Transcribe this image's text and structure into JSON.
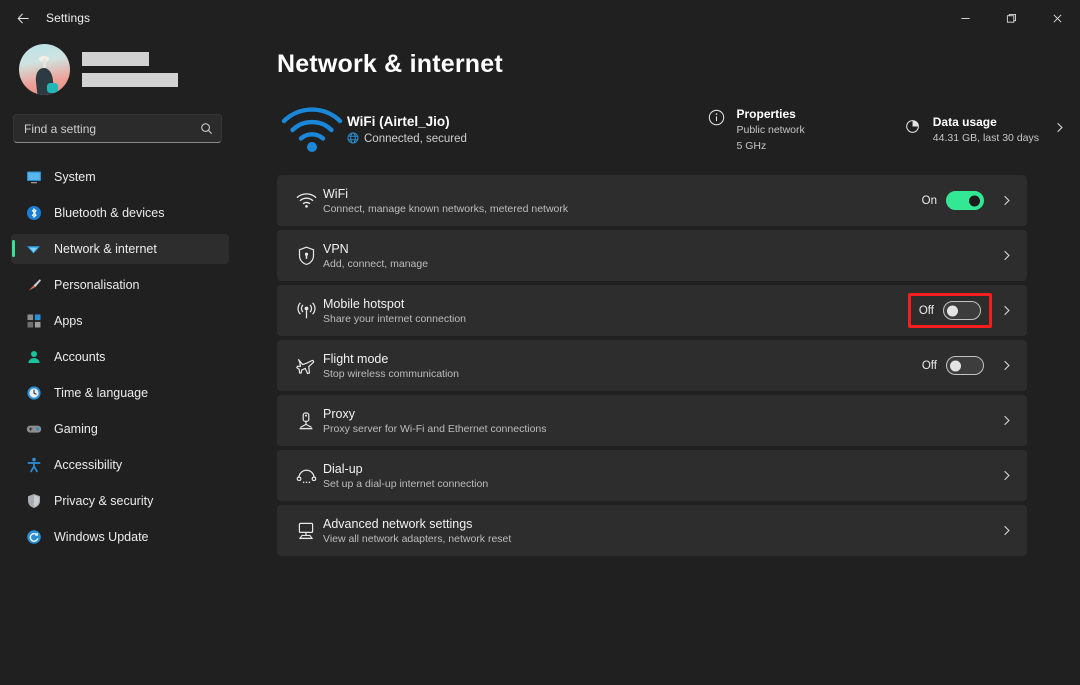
{
  "window": {
    "title": "Settings",
    "back_icon": "back-arrow-icon",
    "minimize_label": "—",
    "restore_label": "❐",
    "close_label": "✕"
  },
  "account": {
    "name_redacted": true
  },
  "search": {
    "placeholder": "Find a setting",
    "value": "",
    "icon": "search-icon"
  },
  "sidebar": {
    "items": [
      {
        "label": "System",
        "icon": "system-icon",
        "active": false
      },
      {
        "label": "Bluetooth & devices",
        "icon": "bluetooth-icon",
        "active": false
      },
      {
        "label": "Network & internet",
        "icon": "network-icon",
        "active": true
      },
      {
        "label": "Personalisation",
        "icon": "brush-icon",
        "active": false
      },
      {
        "label": "Apps",
        "icon": "apps-icon",
        "active": false
      },
      {
        "label": "Accounts",
        "icon": "accounts-icon",
        "active": false
      },
      {
        "label": "Time & language",
        "icon": "clock-icon",
        "active": false
      },
      {
        "label": "Gaming",
        "icon": "gamepad-icon",
        "active": false
      },
      {
        "label": "Accessibility",
        "icon": "accessibility-icon",
        "active": false
      },
      {
        "label": "Privacy & security",
        "icon": "shield-icon",
        "active": false
      },
      {
        "label": "Windows Update",
        "icon": "update-icon",
        "active": false
      }
    ]
  },
  "page": {
    "title": "Network & internet"
  },
  "summary": {
    "wifi_icon": "wifi-icon",
    "ssid": "WiFi (Airtel_Jio)",
    "status": "Connected, secured",
    "status_icon": "globe-icon",
    "properties": {
      "icon": "info-icon",
      "title": "Properties",
      "line1": "Public network",
      "line2": "5 GHz"
    },
    "data_usage": {
      "icon": "pie-chart-icon",
      "title": "Data usage",
      "detail": "44.31 GB, last 30 days",
      "chevron": "chevron-right-icon"
    }
  },
  "rows": [
    {
      "icon": "wifi-icon",
      "title": "WiFi",
      "subtitle": "Connect, manage known networks, metered network",
      "toggle": {
        "present": true,
        "state": "On",
        "on": true,
        "highlighted": false
      },
      "chevron": "chevron-right-icon"
    },
    {
      "icon": "vpn-shield-icon",
      "title": "VPN",
      "subtitle": "Add, connect, manage",
      "toggle": {
        "present": false,
        "state": "",
        "on": false,
        "highlighted": false
      },
      "chevron": "chevron-right-icon"
    },
    {
      "icon": "hotspot-icon",
      "title": "Mobile hotspot",
      "subtitle": "Share your internet connection",
      "toggle": {
        "present": true,
        "state": "Off",
        "on": false,
        "highlighted": true
      },
      "chevron": "chevron-right-icon"
    },
    {
      "icon": "airplane-icon",
      "title": "Flight mode",
      "subtitle": "Stop wireless communication",
      "toggle": {
        "present": true,
        "state": "Off",
        "on": false,
        "highlighted": false
      },
      "chevron": "chevron-right-icon"
    },
    {
      "icon": "proxy-icon",
      "title": "Proxy",
      "subtitle": "Proxy server for Wi-Fi and Ethernet connections",
      "toggle": {
        "present": false,
        "state": "",
        "on": false,
        "highlighted": false
      },
      "chevron": "chevron-right-icon"
    },
    {
      "icon": "dialup-phone-icon",
      "title": "Dial-up",
      "subtitle": "Set up a dial-up internet connection",
      "toggle": {
        "present": false,
        "state": "",
        "on": false,
        "highlighted": false
      },
      "chevron": "chevron-right-icon"
    },
    {
      "icon": "advanced-network-icon",
      "title": "Advanced network settings",
      "subtitle": "View all network adapters, network reset",
      "toggle": {
        "present": false,
        "state": "",
        "on": false,
        "highlighted": false
      },
      "chevron": "chevron-right-icon"
    }
  ],
  "colors": {
    "accent_green": "#33e894",
    "highlight_red": "#f41e1e",
    "wifi_blue": "#1b87d8",
    "page_bg": "#202020",
    "card_bg": "#2d2d2d"
  }
}
